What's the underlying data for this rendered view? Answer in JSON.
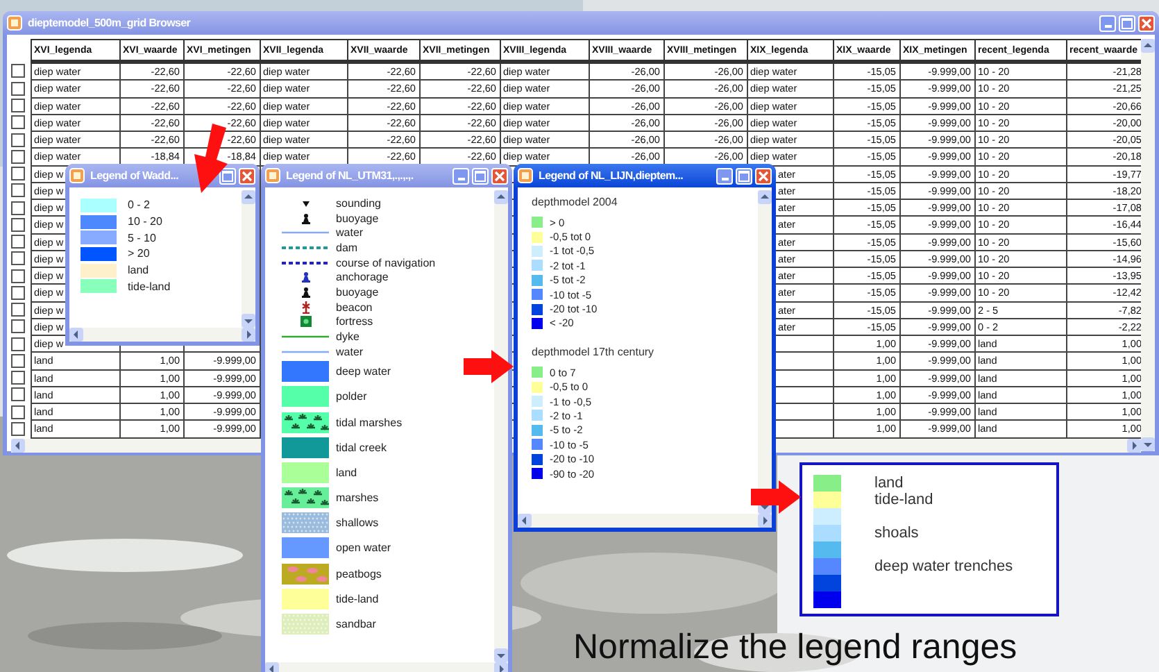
{
  "browser": {
    "title": "dieptemodel_500m_grid Browser",
    "active": false,
    "columns": [
      {
        "label": "XVI_legenda",
        "kind": "text"
      },
      {
        "label": "XVI_waarde",
        "kind": "number"
      },
      {
        "label": "XVI_metingen",
        "kind": "number"
      },
      {
        "label": "XVII_legenda",
        "kind": "text"
      },
      {
        "label": "XVII_waarde",
        "kind": "number"
      },
      {
        "label": "XVII_metingen",
        "kind": "number"
      },
      {
        "label": "XVIII_legenda",
        "kind": "text"
      },
      {
        "label": "XVIII_waarde",
        "kind": "number"
      },
      {
        "label": "XVIII_metingen",
        "kind": "number"
      },
      {
        "label": "XIX_legenda",
        "kind": "text"
      },
      {
        "label": "XIX_waarde",
        "kind": "number"
      },
      {
        "label": "XIX_metingen",
        "kind": "number"
      },
      {
        "label": "recent_legenda",
        "kind": "text"
      },
      {
        "label": "recent_waarde",
        "kind": "number"
      }
    ],
    "rows": [
      {
        "checked": false,
        "cells": [
          "diep water",
          "-22,60",
          "-22,60",
          "diep water",
          "-22,60",
          "-22,60",
          "diep water",
          "-26,00",
          "-26,00",
          "diep water",
          "-15,05",
          "-9.999,00",
          "10 - 20",
          "-21,28"
        ]
      },
      {
        "checked": false,
        "cells": [
          "diep water",
          "-22,60",
          "-22,60",
          "diep water",
          "-22,60",
          "-22,60",
          "diep water",
          "-26,00",
          "-26,00",
          "diep water",
          "-15,05",
          "-9.999,00",
          "10 - 20",
          "-21,25"
        ]
      },
      {
        "checked": false,
        "cells": [
          "diep water",
          "-22,60",
          "-22,60",
          "diep water",
          "-22,60",
          "-22,60",
          "diep water",
          "-26,00",
          "-26,00",
          "diep water",
          "-15,05",
          "-9.999,00",
          "10 - 20",
          "-20,66"
        ]
      },
      {
        "checked": false,
        "cells": [
          "diep water",
          "-22,60",
          "-22,60",
          "diep water",
          "-22,60",
          "-22,60",
          "diep water",
          "-26,00",
          "-26,00",
          "diep water",
          "-15,05",
          "-9.999,00",
          "10 - 20",
          "-20,00"
        ]
      },
      {
        "checked": false,
        "cells": [
          "diep water",
          "-22,60",
          "-22,60",
          "diep water",
          "-22,60",
          "-22,60",
          "diep water",
          "-26,00",
          "-26,00",
          "diep water",
          "-15,05",
          "-9.999,00",
          "10 - 20",
          "-20,05"
        ]
      },
      {
        "checked": false,
        "cells": [
          "diep water",
          "-18,84",
          "-18,84",
          "diep water",
          "-22,60",
          "-22,60",
          "diep water",
          "-26,00",
          "-26,00",
          "diep water",
          "-15,05",
          "-9.999,00",
          "10 - 20",
          "-20,18"
        ]
      },
      {
        "checked": false,
        "cells": [
          "diep w",
          null,
          null,
          null,
          null,
          null,
          null,
          null,
          null,
          {
            "text": "ater",
            "cut": true
          },
          "-15,05",
          "-9.999,00",
          "10 - 20",
          "-19,77"
        ]
      },
      {
        "checked": false,
        "cells": [
          "diep w",
          null,
          null,
          null,
          null,
          null,
          null,
          null,
          null,
          {
            "text": "ater",
            "cut": true
          },
          "-15,05",
          "-9.999,00",
          "10 - 20",
          "-18,20"
        ]
      },
      {
        "checked": false,
        "cells": [
          "diep w",
          null,
          null,
          null,
          null,
          null,
          null,
          null,
          null,
          {
            "text": "ater",
            "cut": true
          },
          "-15,05",
          "-9.999,00",
          "10 - 20",
          "-17,08"
        ]
      },
      {
        "checked": false,
        "cells": [
          "diep w",
          null,
          null,
          null,
          null,
          null,
          null,
          null,
          null,
          {
            "text": "ater",
            "cut": true
          },
          "-15,05",
          "-9.999,00",
          "10 - 20",
          "-16,44"
        ]
      },
      {
        "checked": false,
        "cells": [
          "diep w",
          null,
          null,
          null,
          null,
          null,
          null,
          null,
          null,
          {
            "text": "ater",
            "cut": true
          },
          "-15,05",
          "-9.999,00",
          "10 - 20",
          "-15,60"
        ]
      },
      {
        "checked": false,
        "cells": [
          "diep w",
          null,
          null,
          null,
          null,
          null,
          null,
          null,
          null,
          {
            "text": "ater",
            "cut": true
          },
          "-15,05",
          "-9.999,00",
          "10 - 20",
          "-14,96"
        ]
      },
      {
        "checked": false,
        "cells": [
          "diep w",
          null,
          null,
          null,
          null,
          null,
          null,
          null,
          null,
          {
            "text": "ater",
            "cut": true
          },
          "-15,05",
          "-9.999,00",
          "10 - 20",
          "-13,95"
        ]
      },
      {
        "checked": false,
        "cells": [
          "diep w",
          null,
          null,
          null,
          null,
          null,
          null,
          null,
          null,
          {
            "text": "ater",
            "cut": true
          },
          "-15,05",
          "-9.999,00",
          "10 - 20",
          "-12,42"
        ]
      },
      {
        "checked": false,
        "cells": [
          "diep w",
          null,
          null,
          null,
          null,
          null,
          null,
          null,
          null,
          {
            "text": "ater",
            "cut": true
          },
          "-15,05",
          "-9.999,00",
          "2 - 5",
          "-7,82"
        ]
      },
      {
        "checked": false,
        "cells": [
          "diep w",
          null,
          null,
          null,
          null,
          null,
          null,
          null,
          null,
          {
            "text": "ater",
            "cut": true
          },
          "-15,05",
          "-9.999,00",
          "0 - 2",
          "-2,22"
        ]
      },
      {
        "checked": false,
        "cells": [
          "diep w",
          null,
          null,
          null,
          null,
          null,
          null,
          null,
          null,
          null,
          "1,00",
          "-9.999,00",
          "land",
          "1,00"
        ]
      },
      {
        "checked": false,
        "cells": [
          "land",
          "1,00",
          "-9.999,00",
          null,
          null,
          null,
          null,
          null,
          null,
          null,
          "1,00",
          "-9.999,00",
          "land",
          "1,00"
        ]
      },
      {
        "checked": false,
        "cells": [
          "land",
          "1,00",
          "-9.999,00",
          null,
          null,
          null,
          null,
          null,
          null,
          null,
          "1,00",
          "-9.999,00",
          "land",
          "1,00"
        ]
      },
      {
        "checked": false,
        "cells": [
          "land",
          "1,00",
          "-9.999,00",
          null,
          null,
          null,
          null,
          null,
          null,
          null,
          "1,00",
          "-9.999,00",
          "land",
          "1,00"
        ]
      },
      {
        "checked": false,
        "cells": [
          "land",
          "1,00",
          "-9.999,00",
          null,
          null,
          null,
          null,
          null,
          null,
          null,
          "1,00",
          "-9.999,00",
          "land",
          "1,00"
        ]
      },
      {
        "checked": false,
        "cells": [
          "land",
          "1,00",
          "-9.999,00",
          null,
          null,
          null,
          null,
          null,
          null,
          null,
          "1,00",
          "-9.999,00",
          "land",
          "1,00"
        ]
      }
    ]
  },
  "wadd_legend": {
    "title": "Legend of Wadd...",
    "active": false,
    "items": [
      {
        "label": "0 - 2",
        "color": "#aaffff"
      },
      {
        "label": "10 - 20",
        "color": "#4d88ff"
      },
      {
        "label": "5 - 10",
        "color": "#88aaff"
      },
      {
        "label": "> 20",
        "color": "#0055ff"
      },
      {
        "label": "land",
        "color": "#fff0cc"
      },
      {
        "label": "tide-land",
        "color": "#88ffbb"
      }
    ]
  },
  "utm_legend": {
    "title": "Legend of NL_UTM31,.,.,.,.",
    "active": false,
    "items": [
      {
        "kind": "triangle",
        "color": "#111111",
        "label": "sounding"
      },
      {
        "kind": "buoy",
        "color": "#111111",
        "label": "buoyage"
      },
      {
        "kind": "line",
        "color": "#88aaee",
        "label": "water"
      },
      {
        "kind": "dashed",
        "color": "#229999",
        "label": "dam"
      },
      {
        "kind": "dashed",
        "color": "#2222cc",
        "label": "course of navigation"
      },
      {
        "kind": "buoy",
        "color": "#2233bb",
        "label": "anchorage"
      },
      {
        "kind": "buoy",
        "color": "#111111",
        "label": "buoyage"
      },
      {
        "kind": "beacon",
        "color": "#aa2222",
        "label": "beacon"
      },
      {
        "kind": "square",
        "color": "#118833",
        "label": "fortress"
      },
      {
        "kind": "line",
        "color": "#33aa33",
        "label": "dyke"
      },
      {
        "kind": "line",
        "color": "#88aaee",
        "label": "water"
      },
      {
        "kind": "fill",
        "color": "#3377ff",
        "label": "deep water"
      },
      {
        "kind": "fill",
        "color": "#55ffaa",
        "label": "polder"
      },
      {
        "kind": "marsh",
        "color": "#55ffaa",
        "label": "tidal marshes"
      },
      {
        "kind": "fill",
        "color": "#119999",
        "label": "tidal creek"
      },
      {
        "kind": "fill",
        "color": "#aaff99",
        "label": "land"
      },
      {
        "kind": "marsh",
        "color": "#66ee99",
        "label": "marshes"
      },
      {
        "kind": "dots",
        "color": "#99bbdd",
        "label": "shallows"
      },
      {
        "kind": "fill",
        "color": "#6699ff",
        "label": "open water"
      },
      {
        "kind": "blobs",
        "color": "#bbaa22",
        "label": "peatbogs"
      },
      {
        "kind": "fill",
        "color": "#ffff99",
        "label": "tide-land"
      },
      {
        "kind": "dots",
        "color": "#ddeebb",
        "label": "sandbar"
      }
    ]
  },
  "lijn_legend": {
    "title": "Legend of NL_LIJN,dieptem...",
    "active": true,
    "sections": [
      {
        "heading": "depthmodel 2004",
        "items": [
          {
            "label": "> 0",
            "color": "#88ee88"
          },
          {
            "label": "-0,5 tot 0",
            "color": "#ffff99"
          },
          {
            "label": "-1 tot -0,5",
            "color": "#cceeff"
          },
          {
            "label": "-2 tot -1",
            "color": "#aaddff"
          },
          {
            "label": "-5 tot -2",
            "color": "#55bbee"
          },
          {
            "label": "-10 tot -5",
            "color": "#5588ff"
          },
          {
            "label": "-20 tot -10",
            "color": "#0044dd"
          },
          {
            "label": "< -20",
            "color": "#0000ee"
          }
        ]
      },
      {
        "heading": "depthmodel 17th century",
        "items": [
          {
            "label": "0 to 7",
            "color": "#88ee88"
          },
          {
            "label": "-0,5 to 0",
            "color": "#ffff99"
          },
          {
            "label": "-1 to -0,5",
            "color": "#cceeff"
          },
          {
            "label": "-2 to -1",
            "color": "#aaddff"
          },
          {
            "label": "-5 to -2",
            "color": "#55bbee"
          },
          {
            "label": "-10 to -5",
            "color": "#5588ff"
          },
          {
            "label": "-20 to -10",
            "color": "#0044dd"
          },
          {
            "label": "-90 to -20",
            "color": "#0000ee"
          }
        ]
      }
    ]
  },
  "normalized_legend": {
    "rows": [
      {
        "color": "#88ee88",
        "label": "land"
      },
      {
        "color": "#ffff99",
        "label": "tide-land"
      },
      {
        "color": "#cceeff"
      },
      {
        "color": "#aaddff",
        "label": "shoals"
      },
      {
        "color": "#55bbee"
      },
      {
        "color": "#5588ff",
        "label": "deep water trenches"
      },
      {
        "color": "#0044dd"
      },
      {
        "color": "#0000ee"
      }
    ]
  },
  "caption": "Normalize the legend ranges"
}
